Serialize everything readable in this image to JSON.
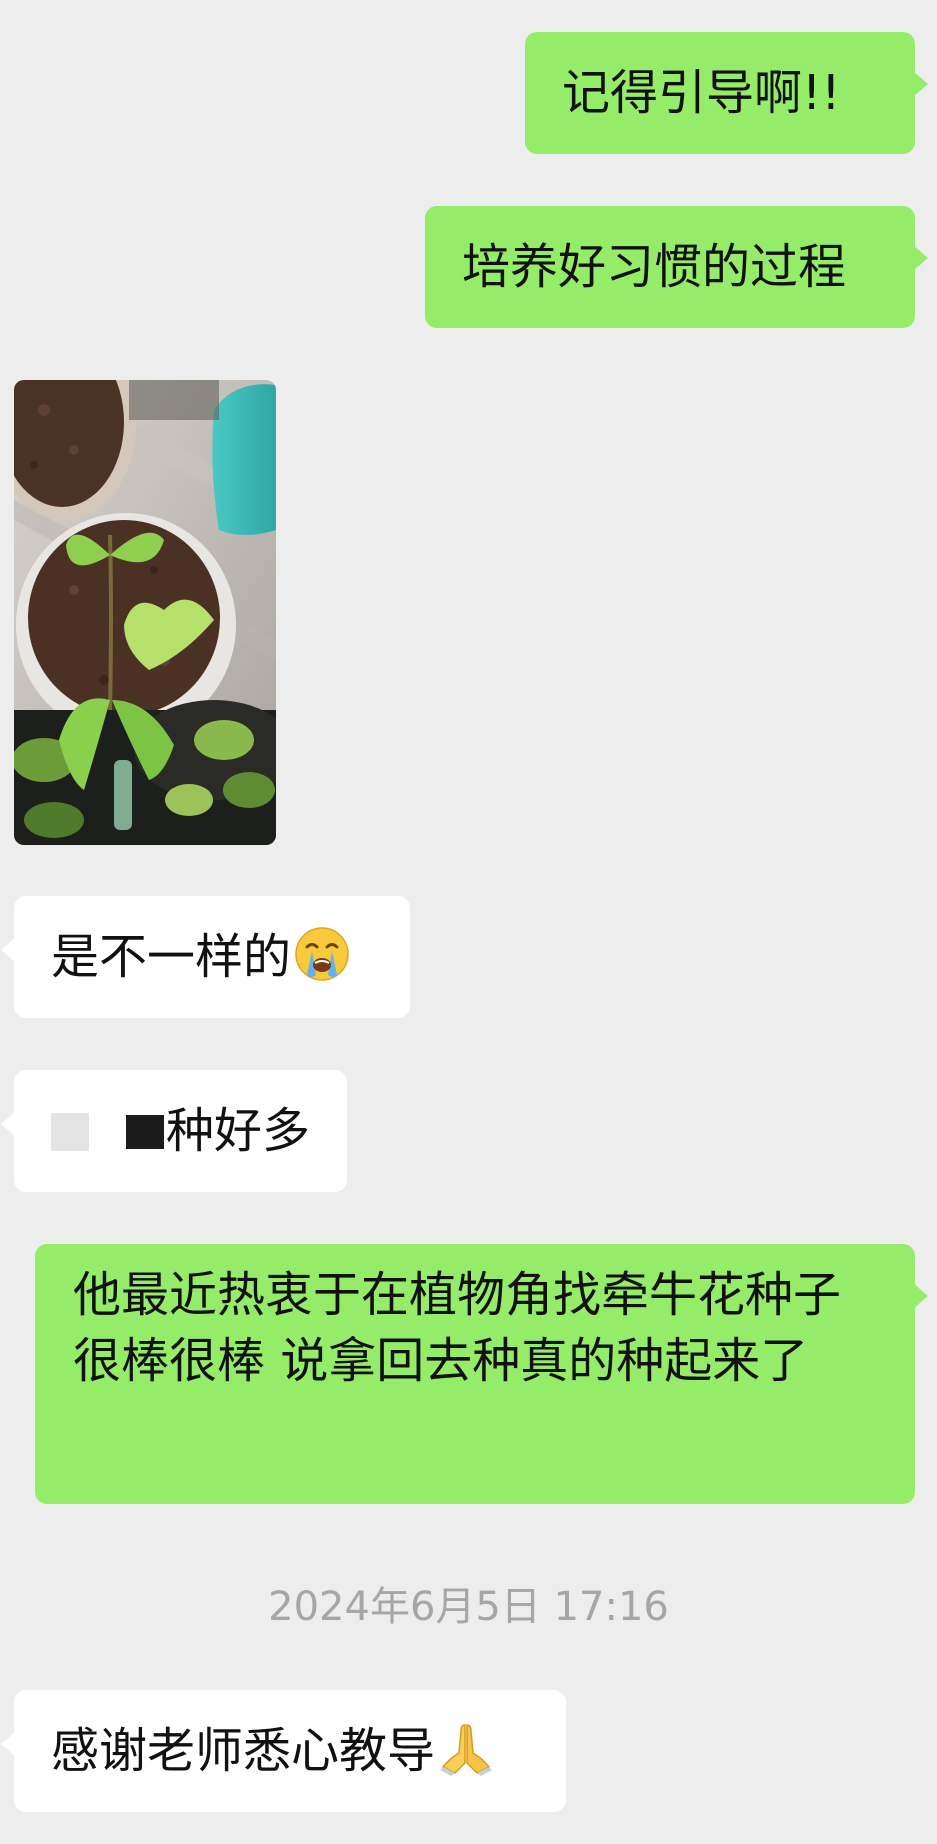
{
  "chat": {
    "messages": [
      {
        "direction": "sent",
        "type": "text",
        "text": "记得引导啊!!"
      },
      {
        "direction": "sent",
        "type": "text",
        "text": "培养好习惯的过程"
      },
      {
        "direction": "received",
        "type": "image",
        "subject": "potted-seedling-photo"
      },
      {
        "direction": "received",
        "type": "text",
        "text": "是不一样的",
        "emoji": "loudly-crying-face"
      },
      {
        "direction": "received",
        "type": "text",
        "text": "种好多",
        "redacted": true
      },
      {
        "direction": "sent",
        "type": "text",
        "text": "他最近热衷于在植物角找牵牛花种子 很棒很棒 说拿回去种真的种起来了"
      },
      {
        "direction": "received",
        "type": "text",
        "text": "感谢老师悉心教导",
        "emoji": "folded-hands"
      }
    ],
    "timestamp": "2024年6月5日 17:16"
  },
  "colors": {
    "background": "#ededed",
    "sent_bubble": "#95ec69",
    "received_bubble": "#ffffff",
    "timestamp_text": "#a6a6a6"
  }
}
